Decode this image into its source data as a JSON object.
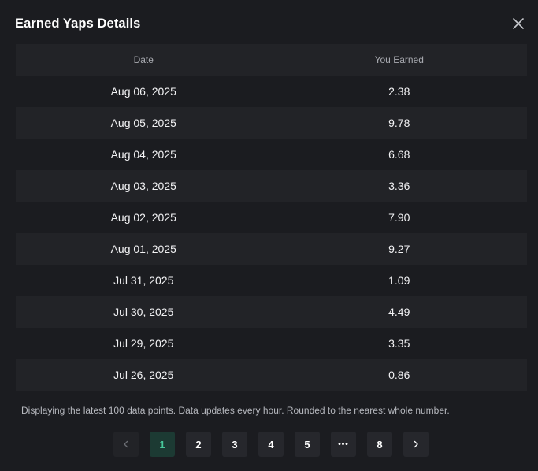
{
  "modal": {
    "title": "Earned Yaps Details",
    "close_icon": "close-icon"
  },
  "table": {
    "headers": [
      "Date",
      "You Earned"
    ],
    "rows": [
      {
        "date": "Aug 06, 2025",
        "earned": "2.38"
      },
      {
        "date": "Aug 05, 2025",
        "earned": "9.78"
      },
      {
        "date": "Aug 04, 2025",
        "earned": "6.68"
      },
      {
        "date": "Aug 03, 2025",
        "earned": "3.36"
      },
      {
        "date": "Aug 02, 2025",
        "earned": "7.90"
      },
      {
        "date": "Aug 01, 2025",
        "earned": "9.27"
      },
      {
        "date": "Jul 31, 2025",
        "earned": "1.09"
      },
      {
        "date": "Jul 30, 2025",
        "earned": "4.49"
      },
      {
        "date": "Jul 29, 2025",
        "earned": "3.35"
      },
      {
        "date": "Jul 26, 2025",
        "earned": "0.86"
      }
    ]
  },
  "note": "Displaying the latest 100 data points. Data updates every hour. Rounded to the nearest whole number.",
  "pagination": {
    "prev_icon": "chevron-left-icon",
    "next_icon": "chevron-right-icon",
    "pages": [
      "1",
      "2",
      "3",
      "4",
      "5",
      "•••",
      "8"
    ],
    "current": "1"
  },
  "colors": {
    "background": "#1b1c20",
    "row_alt": "#222327",
    "accent": "#47c79a"
  }
}
